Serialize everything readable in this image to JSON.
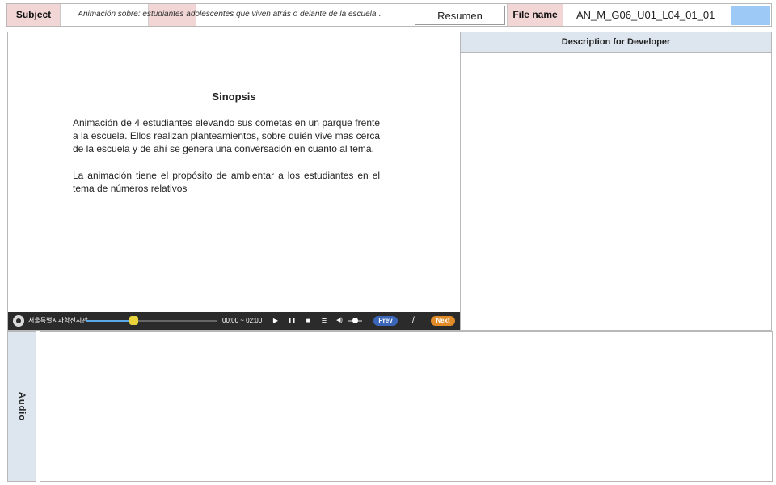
{
  "header": {
    "subject_label": "Subject",
    "subject_text": "¨Animación sobre: estudiantes adolescentes que viven atrás o delante de la escuela¨.",
    "resumen_label": "Resumen",
    "file_name_label": "File name",
    "file_name_value": "AN_M_G06_U01_L04_01_01"
  },
  "content": {
    "title": "Sinopsis",
    "paragraphs": [
      "Animación de 4 estudiantes elevando sus cometas en un parque frente a la escuela. Ellos realizan planteamientos, sobre quién vive mas cerca de la escuela y de ahí se genera una conversación en cuanto al tema.",
      "La animación tiene el propósito de ambientar a los estudiantes en el tema de números relativos"
    ]
  },
  "player": {
    "org_name": "서울특별시과학전시관",
    "time": "00:00 ~ 02:00",
    "progress": 0.36,
    "controls": {
      "play_icon": "▶",
      "pause_icon": "❚❚",
      "stop_icon": "■",
      "menu_icon": "≡",
      "volume_icon": "◀)"
    },
    "prev_label": "Prev",
    "separator": "/",
    "next_label": "Next"
  },
  "developer_panel": {
    "title": "Description for Developer"
  },
  "audio": {
    "label": "Audio"
  },
  "colors": {
    "label_pink": "#f2d6d6",
    "label_blue": "#dde6ef",
    "accent_blue": "#9cc9f5",
    "prev_button": "#3b66b8",
    "next_button": "#e08a28",
    "player_bg": "#2b2b2b"
  }
}
